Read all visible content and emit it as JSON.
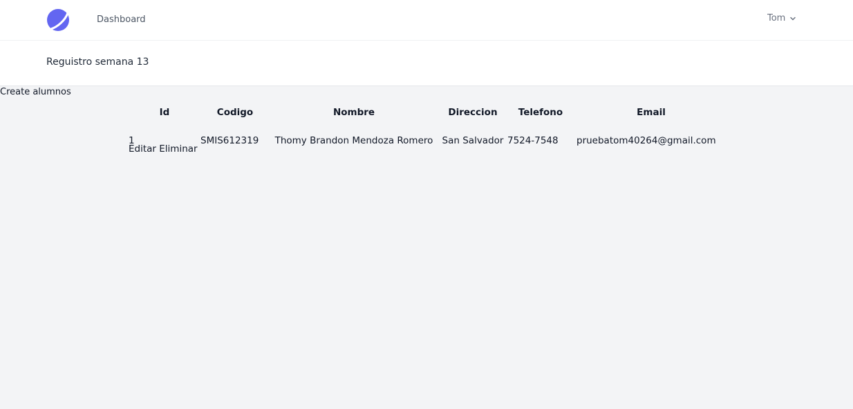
{
  "nav": {
    "dashboard_label": "Dashboard",
    "user_name": "Tom"
  },
  "header": {
    "title": "Reguistro semana 13"
  },
  "create_link": "Create alumnos",
  "table": {
    "headers": [
      "Id",
      "Codigo",
      "Nombre",
      "Direccion",
      "Telefono",
      "Email"
    ],
    "rows": [
      {
        "id": "1",
        "codigo": "SMIS612319",
        "nombre": "Thomy Brandon Mendoza Romero",
        "direccion": "San Salvador",
        "telefono": "7524-7548",
        "email": "pruebatom40264@gmail.com",
        "edit_label": "Editar",
        "delete_label": "Eliminar"
      }
    ]
  },
  "colors": {
    "logo": "#6366f1",
    "page_bg": "#f3f4f6",
    "header_bg": "#ffffff"
  }
}
